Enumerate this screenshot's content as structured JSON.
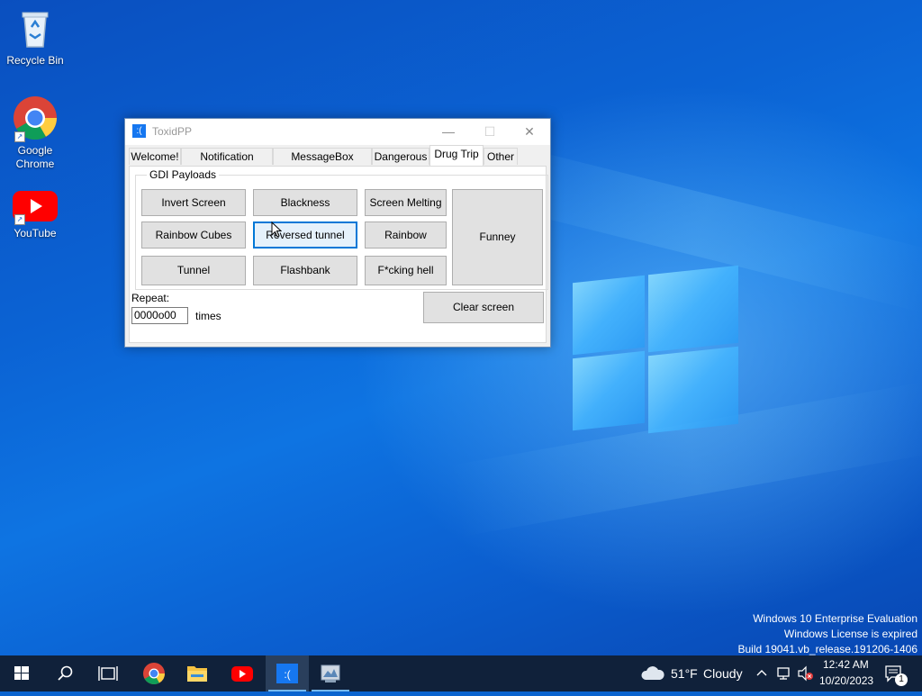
{
  "desktop": {
    "icons": [
      {
        "label": "Recycle Bin"
      },
      {
        "label": "Google\nChrome"
      },
      {
        "label": "YouTube"
      }
    ],
    "watermark": {
      "line1": "Windows 10 Enterprise Evaluation",
      "line2": "Windows License is expired",
      "line3": "Build 19041.vb_release.191206-1406"
    }
  },
  "window": {
    "title": "ToxidPP",
    "icon_glyph": ":(",
    "minimize_glyph": "—",
    "maximize_glyph": "☐",
    "close_glyph": "✕",
    "tabs": [
      {
        "label": "Welcome!"
      },
      {
        "label": "Notification Creator"
      },
      {
        "label": "MessageBox Creator"
      },
      {
        "label": "Dangerous"
      },
      {
        "label": "Drug Trip",
        "active": true
      },
      {
        "label": "Other"
      }
    ],
    "group_label": "GDI Payloads",
    "buttons": {
      "invert_screen": "Invert Screen",
      "blackness": "Blackness",
      "screen_melting": "Screen Melting",
      "funney": "Funney",
      "rainbow_cubes": "Rainbow Cubes",
      "reversed_tunnel": "Reversed tunnel",
      "rainbow": "Rainbow",
      "tunnel": "Tunnel",
      "flashbank": "Flashbank",
      "fcking_hell": "F*cking hell",
      "clear_screen": "Clear screen"
    },
    "repeat_label": "Repeat:",
    "repeat_value": "0000o00",
    "times_label": "times"
  },
  "taskbar": {
    "icons": [
      "start-icon",
      "search-icon",
      "task-view-icon",
      "chrome-icon",
      "file-explorer-icon",
      "youtube-icon",
      "toxidpp-icon",
      "app-icon"
    ],
    "weather": {
      "temp": "51°F",
      "condition": "Cloudy"
    },
    "clock": {
      "time": "12:42 AM",
      "date": "10/20/2023"
    },
    "notification_count": "1"
  },
  "colors": {
    "accent": "#0078d7",
    "taskbar": "#10213a"
  }
}
